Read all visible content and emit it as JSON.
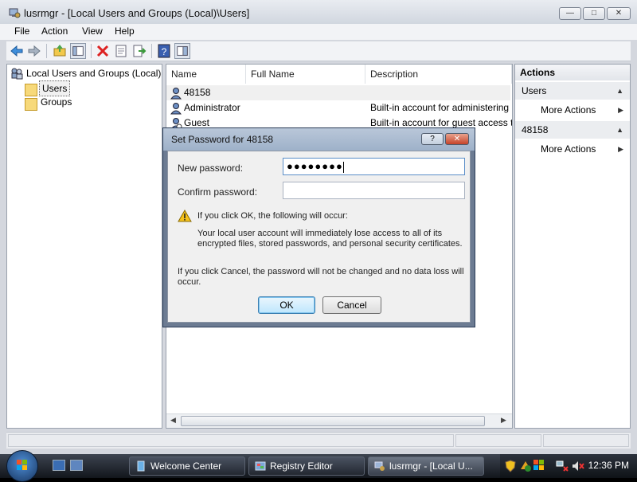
{
  "window": {
    "title": "lusrmgr - [Local Users and Groups (Local)\\Users]",
    "controls": {
      "minimize": "—",
      "maximize": "□",
      "close": "✕"
    }
  },
  "menu": [
    "File",
    "Action",
    "View",
    "Help"
  ],
  "toolbar_icons": [
    "back-icon",
    "forward-icon",
    "up-folder-icon",
    "show-hide-tree-icon",
    "delete-icon",
    "properties-icon",
    "export-list-icon",
    "help-icon",
    "action-pane-icon"
  ],
  "tree": {
    "root": "Local Users and Groups (Local)",
    "children": [
      "Users",
      "Groups"
    ],
    "selected": "Users"
  },
  "list": {
    "columns": [
      "Name",
      "Full Name",
      "Description"
    ],
    "rows": [
      {
        "name": "48158",
        "full_name": "",
        "description": ""
      },
      {
        "name": "Administrator",
        "full_name": "",
        "description": "Built-in account for administering"
      },
      {
        "name": "Guest",
        "full_name": "",
        "description": "Built-in account for guest access t"
      }
    ]
  },
  "actions": {
    "header": "Actions",
    "sections": [
      {
        "title": "Users",
        "items": [
          "More Actions"
        ]
      },
      {
        "title": "48158",
        "items": [
          "More Actions"
        ]
      }
    ]
  },
  "dialog": {
    "title": "Set Password for 48158",
    "help_btn": "?",
    "close_btn": "✕",
    "new_password_label": "New password:",
    "new_password_value": "●●●●●●●●",
    "confirm_password_label": "Confirm password:",
    "confirm_password_value": "",
    "warning_heading": "If you click OK, the following will occur:",
    "warning_detail_1": "Your local user account will immediately lose access to all of its",
    "warning_detail_2": "encrypted files, stored passwords, and personal security certificates.",
    "cancel_note_1": "If you click Cancel, the password will not be changed and no data loss will",
    "cancel_note_2": "occur.",
    "ok_label": "OK",
    "cancel_label": "Cancel"
  },
  "taskbar": {
    "buttons": [
      {
        "label": "Welcome Center",
        "active": false
      },
      {
        "label": "Registry Editor",
        "active": false
      },
      {
        "label": "lusrmgr - [Local U...",
        "active": true
      }
    ],
    "clock": "12:36 PM"
  }
}
